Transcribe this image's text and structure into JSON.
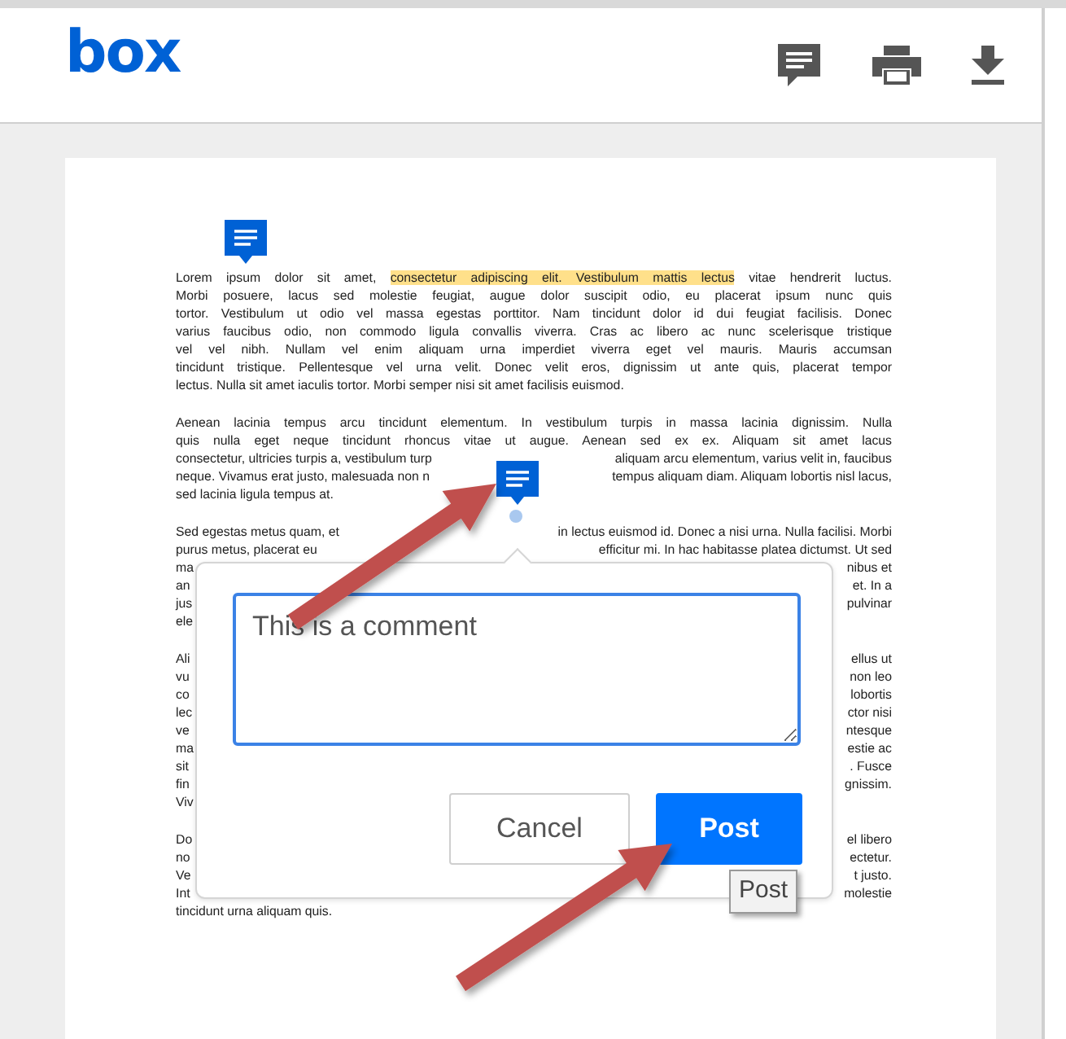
{
  "header": {
    "logo": "box"
  },
  "document": {
    "paragraphs": [
      {
        "lines": [
          {
            "kind": "highlighted",
            "text_before": "Lorem ipsum dolor sit amet, ",
            "highlight": "consectetur adipiscing elit. Vestibulum mattis lectus",
            "text_after": " vitae hendrerit luctus."
          },
          {
            "kind": "full",
            "text": "Morbi posuere, lacus sed molestie feugiat, augue dolor suscipit odio, eu placerat ipsum nunc quis"
          },
          {
            "kind": "full",
            "text": "tortor. Vestibulum ut odio vel massa egestas porttitor. Nam tincidunt dolor id dui feugiat facilisis. Donec"
          },
          {
            "kind": "full",
            "text": "varius faucibus odio, non commodo ligula convallis viverra. Cras ac libero ac nunc scelerisque tristique"
          },
          {
            "kind": "full",
            "text": "vel vel nibh. Nullam vel enim aliquam urna imperdiet viverra eget vel mauris. Mauris accumsan"
          },
          {
            "kind": "full",
            "text": "tincidunt tristique. Pellentesque vel urna velit. Donec velit eros, dignissim ut ante quis, placerat tempor"
          },
          {
            "kind": "full",
            "text": "lectus. Nulla sit amet iaculis tortor. Morbi semper nisi sit amet facilisis euismod."
          }
        ]
      },
      {
        "lines": [
          {
            "kind": "full",
            "text": "Aenean lacinia tempus arcu tincidunt elementum. In vestibulum turpis in massa lacinia dignissim. Nulla"
          },
          {
            "kind": "full",
            "text": "quis nulla eget neque tincidunt rhoncus vitae ut augue. Aenean sed ex ex. Aliquam sit amet lacus"
          },
          {
            "kind": "split",
            "left": "consectetur, ultricies turpis a, vestibulum turp",
            "right": "aliquam arcu elementum, varius velit in, faucibus"
          },
          {
            "kind": "split",
            "left": "neque. Vivamus erat justo, malesuada non n",
            "right": "tempus aliquam diam. Aliquam lobortis nisl lacus,"
          },
          {
            "kind": "full",
            "text": "sed lacinia ligula tempus at."
          }
        ]
      },
      {
        "lines": [
          {
            "kind": "split",
            "left": "Sed egestas metus quam, et",
            "right": "in lectus euismod id. Donec a nisi urna. Nulla facilisi. Morbi"
          },
          {
            "kind": "split",
            "left": "purus metus, placerat eu",
            "right": "efficitur mi. In hac habitasse platea dictumst. Ut sed"
          },
          {
            "kind": "split",
            "left": "ma",
            "right": "nibus et"
          },
          {
            "kind": "split",
            "left": "an",
            "right": "et. In a"
          },
          {
            "kind": "split",
            "left": "jus",
            "right": "pulvinar"
          },
          {
            "kind": "split",
            "left": "ele"
          }
        ]
      },
      {
        "lines": [
          {
            "kind": "split",
            "left": "Ali",
            "right": "ellus ut"
          },
          {
            "kind": "split",
            "left": "vu",
            "right": "non leo"
          },
          {
            "kind": "split",
            "left": "co",
            "right": "lobortis"
          },
          {
            "kind": "split",
            "left": "lec",
            "right": "ctor nisi"
          },
          {
            "kind": "split",
            "left": "ve",
            "right": "ntesque"
          },
          {
            "kind": "split",
            "left": "ma",
            "right": "estie ac"
          },
          {
            "kind": "split",
            "left": "sit",
            "right": ". Fusce"
          },
          {
            "kind": "split",
            "left": "fin",
            "right": "gnissim."
          },
          {
            "kind": "split",
            "left": "Viv"
          }
        ]
      },
      {
        "lines": [
          {
            "kind": "split",
            "left": "Do",
            "right": "el libero"
          },
          {
            "kind": "split",
            "left": "no",
            "right": "ectetur."
          },
          {
            "kind": "split",
            "left": "Ve",
            "right": "t justo."
          },
          {
            "kind": "split",
            "left": "Int",
            "right": "molestie"
          },
          {
            "kind": "full",
            "text": "tincidunt urna aliquam quis."
          }
        ]
      }
    ]
  },
  "comment_popup": {
    "placeholder": "This is a comment",
    "buttons": [
      {
        "label": "Cancel",
        "kind": "secondary"
      },
      {
        "label": "Post",
        "kind": "primary"
      }
    ],
    "tooltip": "Post"
  }
}
